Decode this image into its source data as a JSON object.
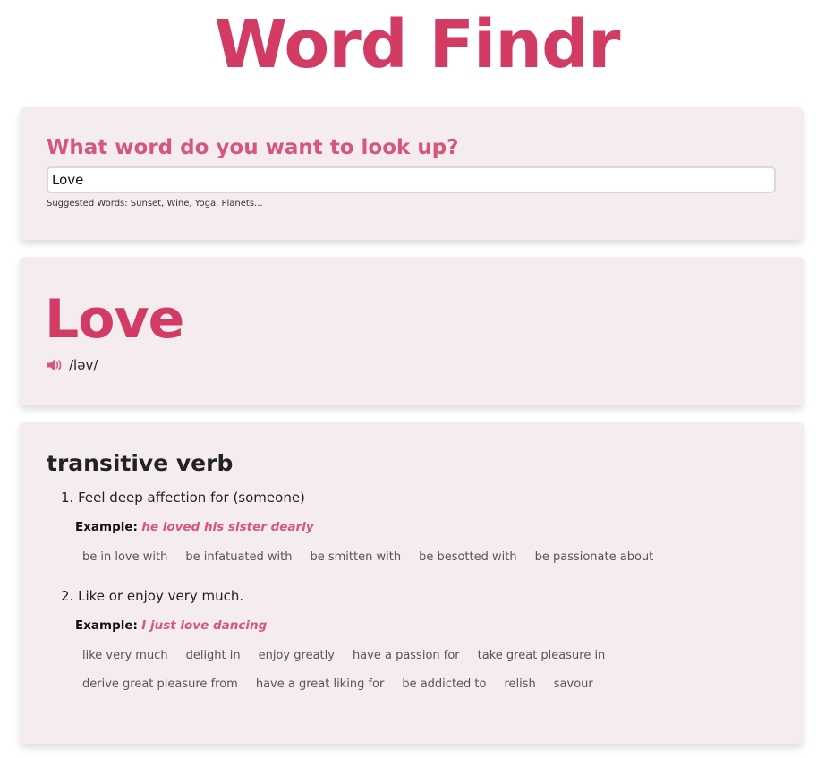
{
  "header": {
    "title": "Word Findr"
  },
  "search": {
    "heading": "What word do you want to look up?",
    "value": "Love",
    "suggested": "Suggested Words: Sunset, Wine, Yoga, Planets..."
  },
  "word": {
    "text": "Love",
    "phonetic": "/ləv/",
    "audio_icon": "speaker-icon"
  },
  "definitions": {
    "part_of_speech": "transitive verb",
    "example_label": "Example:",
    "meanings": [
      {
        "number": "1.",
        "definition": "Feel deep affection for (someone)",
        "example": "he loved his sister dearly",
        "synonyms": [
          "be in love with",
          "be infatuated with",
          "be smitten with",
          "be besotted with",
          "be passionate about"
        ]
      },
      {
        "number": "2.",
        "definition": "Like or enjoy very much.",
        "example": "I just love dancing",
        "synonyms": [
          "like very much",
          "delight in",
          "enjoy greatly",
          "have a passion for",
          "take great pleasure in",
          "derive great pleasure from",
          "have a great liking for",
          "be addicted to",
          "relish",
          "savour"
        ]
      }
    ]
  },
  "colors": {
    "accent": "#d23b64",
    "accent_light": "#d6577c",
    "card_bg": "#f4ecee"
  }
}
